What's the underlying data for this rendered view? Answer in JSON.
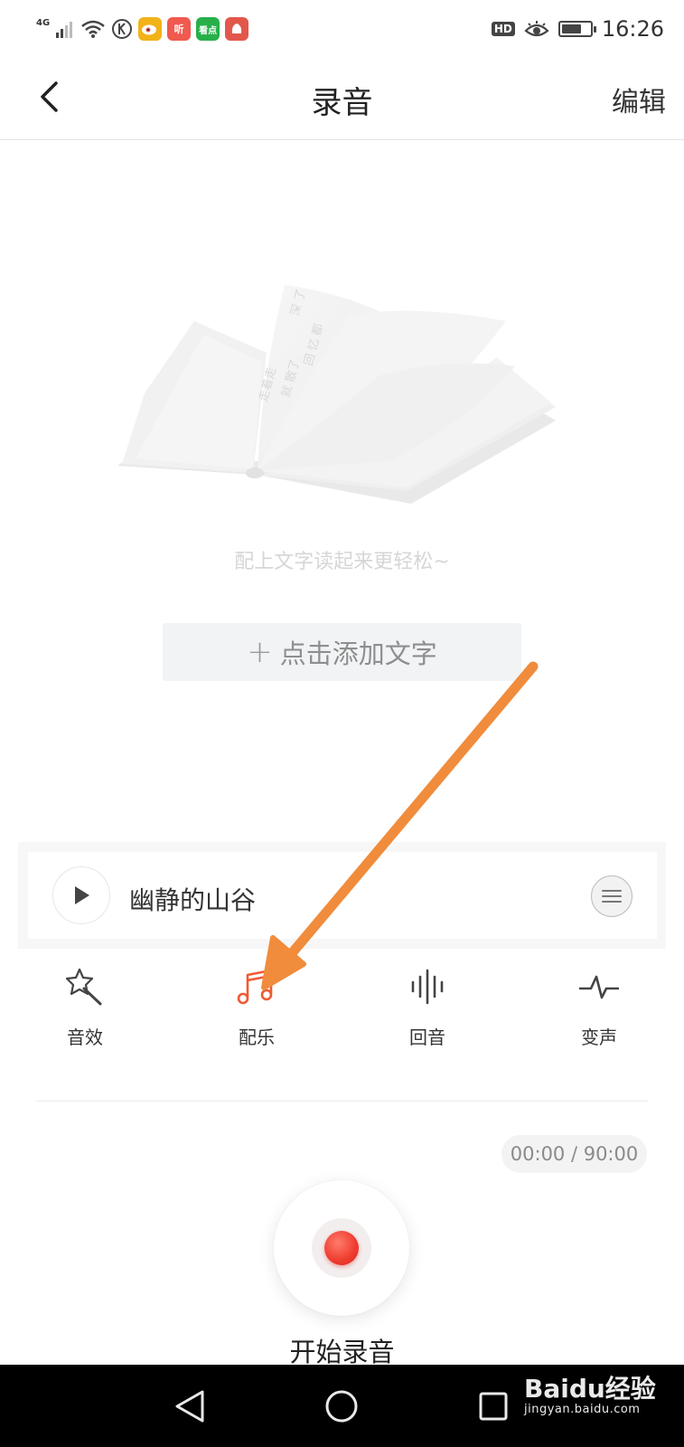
{
  "status_bar": {
    "network": "4G",
    "apps": [
      {
        "label": "",
        "color": "#f2b21a"
      },
      {
        "label": "听",
        "color": "#f05a4f"
      },
      {
        "label": "看点",
        "color": "#27b04a"
      },
      {
        "label": "",
        "color": "#e2574c"
      }
    ],
    "hd": "HD",
    "time": "16:26",
    "battery_level": 0.7
  },
  "nav": {
    "title": "录音",
    "edit_label": "编辑"
  },
  "illustration": {
    "page_text_1": "走着走",
    "page_text_2": "就 散了",
    "page_text_3": "回 忆 都",
    "page_text_4": "深 了"
  },
  "main": {
    "hint": "配上文字读起来更轻松~",
    "add_text_label": "点击添加文字"
  },
  "music": {
    "track_name": "幽静的山谷"
  },
  "tools": [
    {
      "label": "音效",
      "icon": "magic-wand-icon",
      "active": false
    },
    {
      "label": "配乐",
      "icon": "music-note-icon",
      "active": true
    },
    {
      "label": "回音",
      "icon": "sound-wave-icon",
      "active": false
    },
    {
      "label": "变声",
      "icon": "pulse-icon",
      "active": false
    }
  ],
  "recorder": {
    "timer": "00:00 / 90:00",
    "record_label": "开始录音"
  },
  "colors": {
    "accent": "#ef5a32",
    "arrow": "#f08c3c",
    "record": "#ee3b2e"
  },
  "watermark": {
    "brand": "Baidu经验",
    "url": "jingyan.baidu.com"
  }
}
